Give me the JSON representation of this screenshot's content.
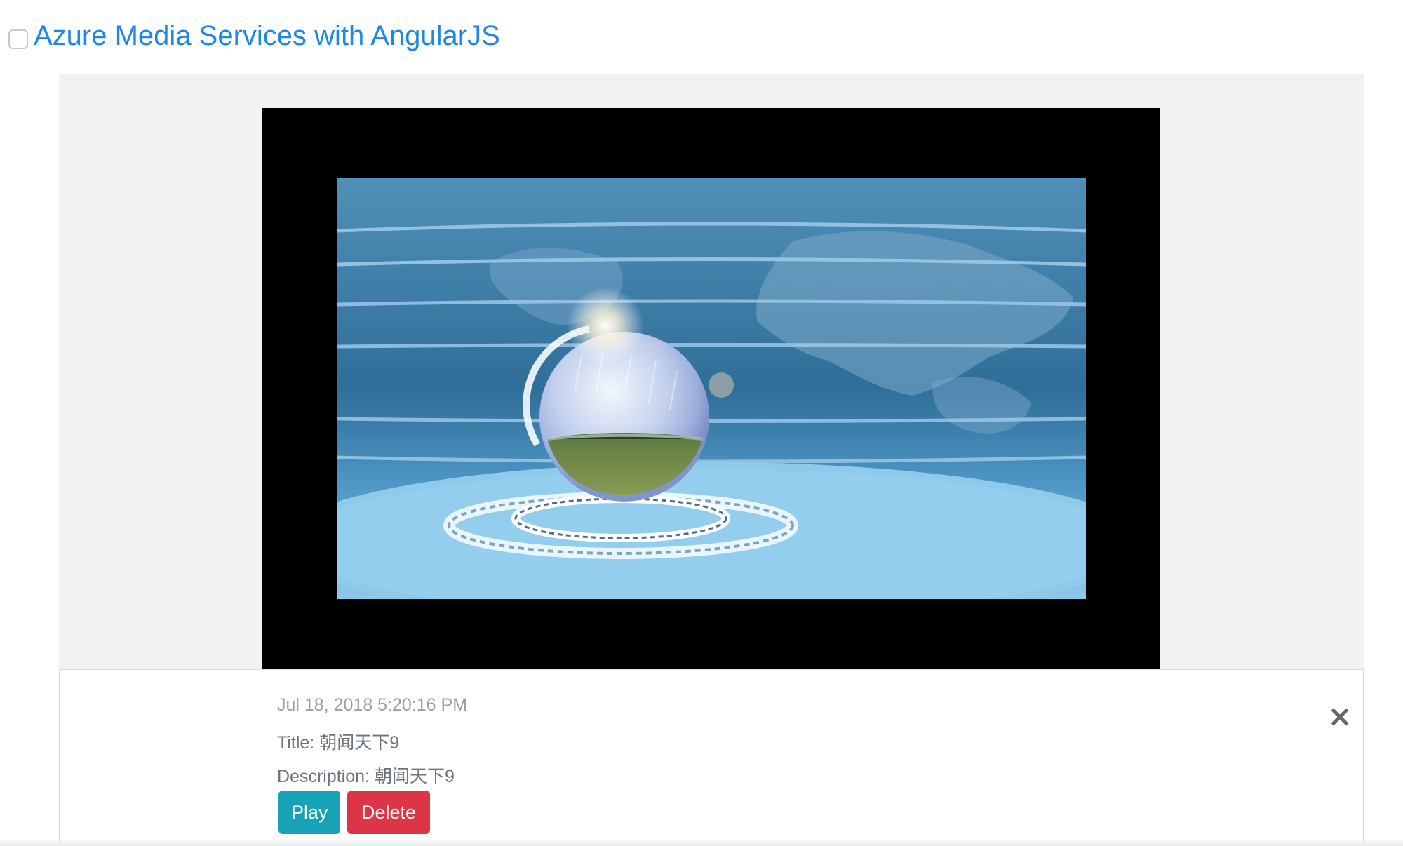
{
  "header": {
    "title": "Azure Media Services with AngularJS",
    "checkbox_checked": false
  },
  "media_item": {
    "date": "Jul 18, 2018 5:20:16 PM",
    "title_line": "Title: 朝闻天下9",
    "description_line": "Description: 朝闻天下9",
    "thumbnail_description": "news-studio-globe"
  },
  "actions": {
    "play_label": "Play",
    "delete_label": "Delete",
    "close_icon": "close-icon"
  },
  "colors": {
    "link": "#1f87e5",
    "play": "#17a2b8",
    "delete": "#dc3545",
    "card_bg": "#f2f2f2"
  }
}
